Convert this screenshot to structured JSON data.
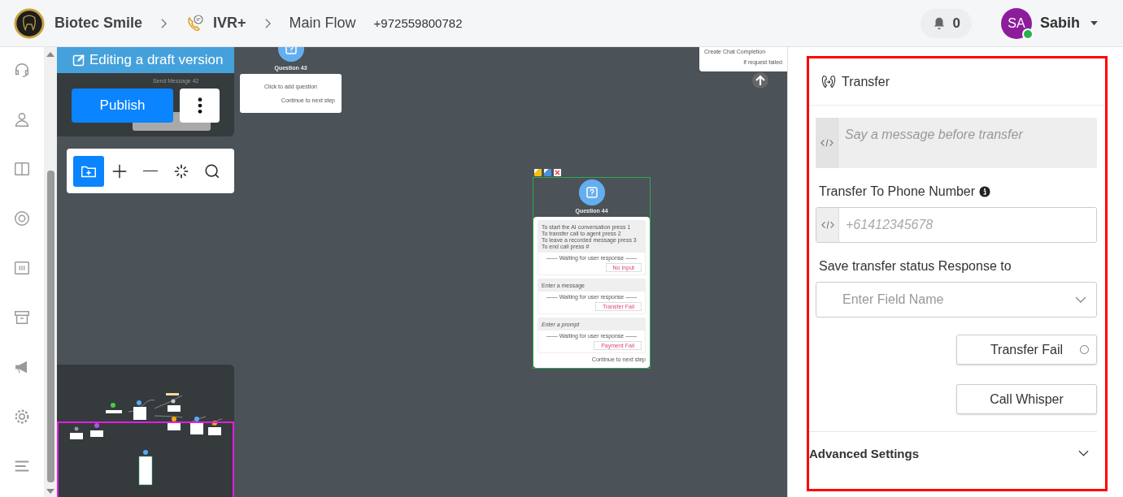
{
  "header": {
    "breadcrumbs": [
      {
        "text": "Biotec Smile",
        "kind": "org"
      },
      {
        "text": "IVR+",
        "kind": "flow"
      },
      {
        "text": "Main Flow",
        "kind": "page"
      }
    ],
    "phone": "+972559800782",
    "notifications": {
      "count": "0"
    },
    "user": {
      "initials": "SA",
      "name": "Sabih",
      "online": true
    }
  },
  "draft": {
    "banner": "Editing a draft version",
    "hidden_node_title": "Send Message 42",
    "publish": "Publish"
  },
  "canvas": {
    "nodes": [
      {
        "kind": "simple",
        "title": "Question 43",
        "body": "Click to add question",
        "footer": "Continue to next step"
      },
      {
        "kind": "question",
        "title": "Question 44",
        "selected": true,
        "sections": [
          {
            "prompt": [
              "To start the AI conversation press 1",
              "To transfer call to agent press 2",
              "To leave a recorded message press 3",
              "To end call press #"
            ],
            "italic": false,
            "waiting": "—— Waiting for user response ——",
            "exit": "No Input"
          },
          {
            "prompt": [
              "Enter a message"
            ],
            "italic": false,
            "waiting": "—— Waiting for user response ——",
            "exit": "Transfer Fail"
          },
          {
            "prompt": [
              "Enter a prompt"
            ],
            "italic": true,
            "waiting": "—— Waiting for user response ——",
            "exit": "Payment Fail"
          }
        ],
        "footer": "Continue to next step"
      },
      {
        "kind": "partial",
        "title": "Create Chat Completion",
        "exit": "If request failed"
      }
    ]
  },
  "panel": {
    "title": "Transfer",
    "message_field": {
      "placeholder": "Say a message before transfer"
    },
    "phone_label": "Transfer To Phone Number",
    "phone_field": {
      "placeholder": "+61412345678"
    },
    "status_label": "Save transfer status Response to",
    "status_select": {
      "placeholder": "Enter Field Name"
    },
    "exits": [
      {
        "label": "Transfer Fail",
        "has_port": true
      },
      {
        "label": "Call Whisper",
        "has_port": false
      }
    ],
    "advanced": {
      "label": "Advanced Settings",
      "expanded": false
    }
  }
}
